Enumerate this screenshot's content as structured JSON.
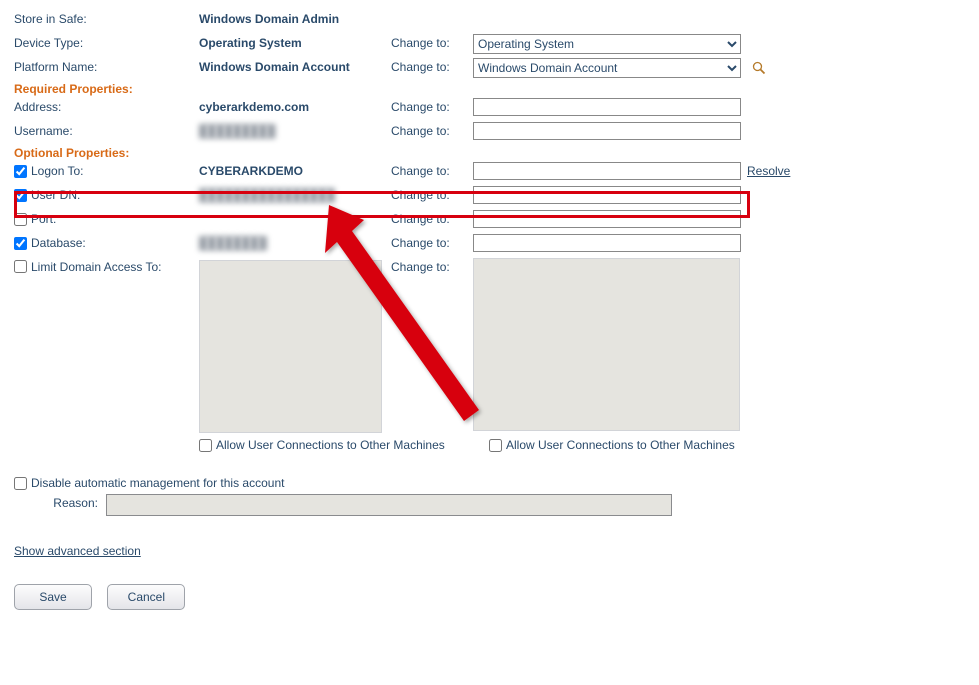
{
  "rows": {
    "store_safe": {
      "label": "Store in Safe:",
      "value": "Windows Domain Admin"
    },
    "device_type": {
      "label": "Device Type:",
      "value": "Operating System",
      "change": "Change to:",
      "select": "Operating System"
    },
    "platform_name": {
      "label": "Platform Name:",
      "value": "Windows Domain Account",
      "change": "Change to:",
      "select": "Windows Domain Account"
    },
    "address": {
      "label": "Address:",
      "value": "cyberarkdemo.com",
      "change": "Change to:"
    },
    "username": {
      "label": "Username:",
      "value": "█████████",
      "change": "Change to:"
    },
    "logon_to": {
      "label": "Logon To:",
      "value": "CYBERARKDEMO",
      "change": "Change to:",
      "resolve": "Resolve"
    },
    "user_dn": {
      "label": "User DN:",
      "value": "████████████████",
      "change": "Change to:"
    },
    "port": {
      "label": "Port:",
      "change": "Change to:"
    },
    "database": {
      "label": "Database:",
      "value": "████████",
      "change": "Change to:"
    },
    "limit_domain": {
      "label": "Limit Domain Access To:",
      "value": "",
      "change": "Change to:"
    }
  },
  "sections": {
    "required": "Required Properties:",
    "optional": "Optional Properties:"
  },
  "allow_left": "Allow User Connections to Other Machines",
  "allow_right": "Allow User Connections to Other Machines",
  "disable_mgmt": "Disable automatic management for this account",
  "reason_label": "Reason:",
  "advanced": "Show advanced section",
  "buttons": {
    "save": "Save",
    "cancel": "Cancel"
  }
}
